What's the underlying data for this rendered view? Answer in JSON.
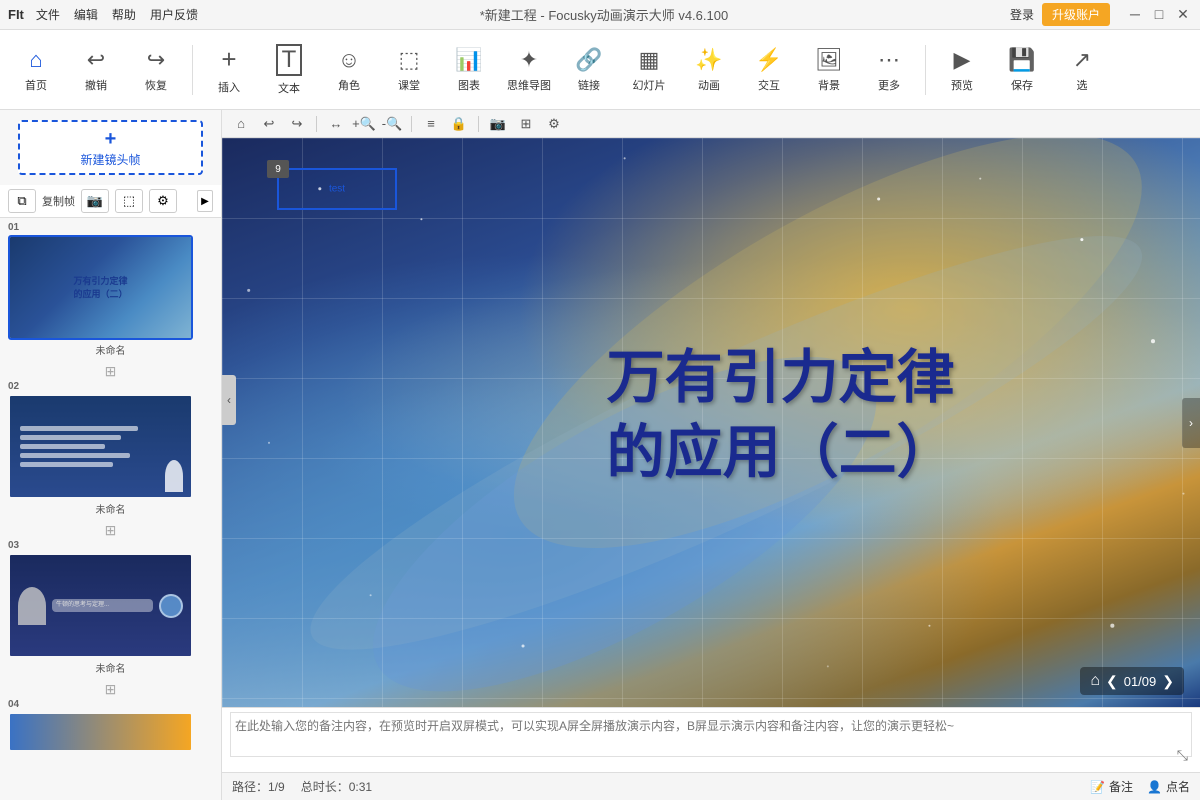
{
  "titlebar": {
    "logo": "FIt",
    "menu": [
      "文件",
      "编辑",
      "帮助",
      "用户反馈"
    ],
    "title": "*新建工程 - Focusky动画演示大师 v4.6.100",
    "login": "登录",
    "upgrade": "升级账户",
    "win_min": "─",
    "win_max": "□",
    "win_close": "✕"
  },
  "toolbar": {
    "items": [
      {
        "id": "home",
        "icon": "⌂",
        "label": "首页"
      },
      {
        "id": "undo",
        "icon": "↩",
        "label": "撤销"
      },
      {
        "id": "redo",
        "icon": "↪",
        "label": "恢复"
      },
      {
        "id": "insert",
        "icon": "+",
        "label": "插入"
      },
      {
        "id": "text",
        "icon": "T",
        "label": "文本"
      },
      {
        "id": "role",
        "icon": "☺",
        "label": "角色"
      },
      {
        "id": "class",
        "icon": "⬚",
        "label": "课堂"
      },
      {
        "id": "chart",
        "icon": "📊",
        "label": "图表"
      },
      {
        "id": "mindmap",
        "icon": "✦",
        "label": "思维导图"
      },
      {
        "id": "link",
        "icon": "🔗",
        "label": "链接"
      },
      {
        "id": "slide",
        "icon": "▦",
        "label": "幻灯片"
      },
      {
        "id": "anim",
        "icon": "✨",
        "label": "动画"
      },
      {
        "id": "interact",
        "icon": "⚡",
        "label": "交互"
      },
      {
        "id": "bg",
        "icon": "🖼",
        "label": "背景"
      },
      {
        "id": "more",
        "icon": "⋯",
        "label": "更多"
      },
      {
        "id": "preview",
        "icon": "▶",
        "label": "预览"
      },
      {
        "id": "save",
        "icon": "💾",
        "label": "保存"
      },
      {
        "id": "select",
        "icon": "↗",
        "label": "选"
      }
    ]
  },
  "slidepanel": {
    "new_frame": "新建镜头帧",
    "controls": [
      "复制帧",
      "📷",
      "⬚",
      "⚙"
    ],
    "slides": [
      {
        "num": "01",
        "name": "未命名",
        "title": "万有引力定律\n的应用（二）"
      },
      {
        "num": "02",
        "name": "未命名"
      },
      {
        "num": "03",
        "name": "未命名"
      },
      {
        "num": "04",
        "name": ""
      }
    ]
  },
  "canvas": {
    "frame_num": "9",
    "frame_label": "test",
    "main_title_line1": "万有引力定律",
    "main_title_line2": "的应用（二）",
    "page_info": "01/09",
    "home_icon": "⌂",
    "prev_icon": "❮",
    "next_icon": "❯"
  },
  "canvas_toolbar": {
    "buttons": [
      "⌂",
      "↩",
      "↗",
      "□",
      "🔍",
      "🔍",
      "↔",
      "⋯",
      "📷",
      "⬚",
      "⚙"
    ]
  },
  "notes": {
    "placeholder": "在此处输入您的备注内容，在预览时开启双屏模式，可以实现A屏全屏播放演示内容，B屏显示演示内容和备注内容，让您的演示更轻松~"
  },
  "statusbar": {
    "path": "路径：1/9",
    "duration": "总时长：0:31",
    "annotation": "备注",
    "point_name": "点名"
  }
}
